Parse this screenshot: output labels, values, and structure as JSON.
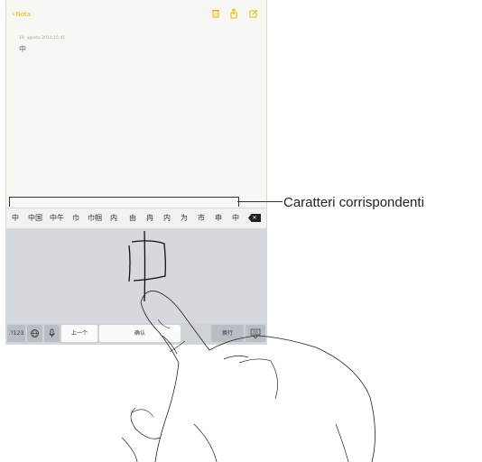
{
  "nav": {
    "back_label": "Nota"
  },
  "toolbar": {
    "trash_icon": "trash-icon",
    "share_icon": "share-icon",
    "compose_icon": "compose-icon"
  },
  "note": {
    "date": "19. agosto 2014 15:41",
    "text": "中"
  },
  "candidates": [
    "中",
    "中国",
    "中午",
    "巾",
    "巾帼",
    "内",
    "由",
    "冉",
    "内",
    "为",
    "市",
    "申",
    "中"
  ],
  "bottom_row": {
    "numbers_key": ".?123",
    "globe_icon": "globe-icon",
    "mic_icon": "mic-icon",
    "prev_key": "上一个",
    "confirm_key": "确认",
    "return_key": "换行",
    "dismiss_icon": "keyboard-dismiss-icon"
  },
  "callout": {
    "label": "Caratteri corrispondenti"
  },
  "colors": {
    "accent": "#e5b800"
  }
}
